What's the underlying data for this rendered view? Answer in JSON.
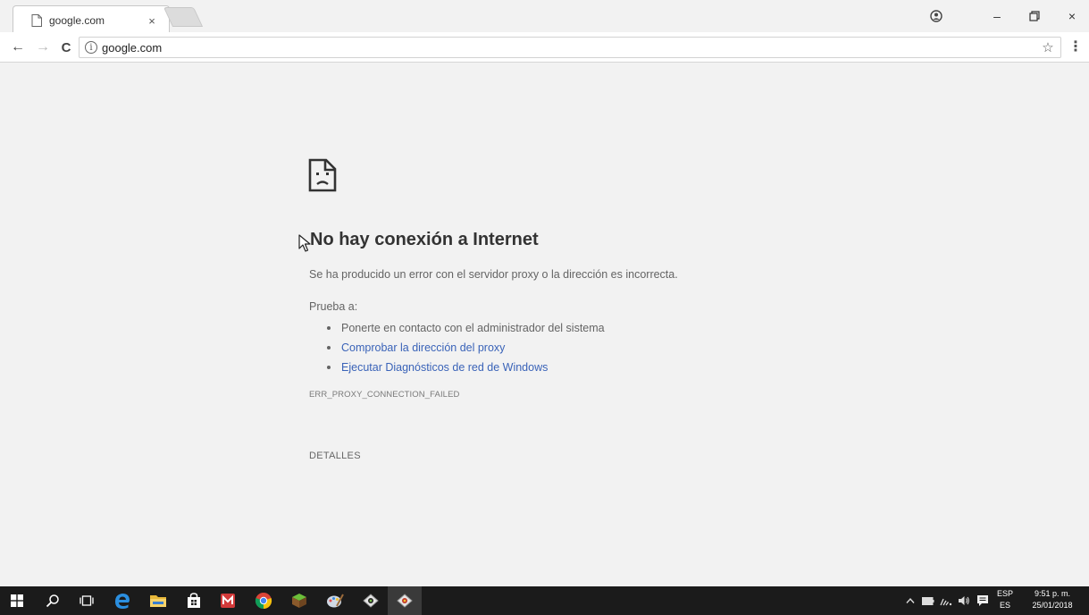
{
  "browser": {
    "tab": {
      "title": "google.com",
      "close": "×"
    },
    "window": {
      "minimize": "–",
      "restore": "▭",
      "close": "×"
    },
    "nav": {
      "back": "←",
      "forward": "→",
      "reload": "C"
    },
    "omnibox": {
      "info": "i",
      "url": "google.com",
      "star": "☆",
      "menu": "⋮"
    }
  },
  "page": {
    "title": "No hay conexión a Internet",
    "description": "Se ha producido un error con el servidor proxy o la dirección es incorrecta.",
    "try_label": "Prueba a:",
    "suggestions": [
      {
        "text": "Ponerte en contacto con el administrador del sistema",
        "link": false
      },
      {
        "text": "Comprobar la dirección del proxy",
        "link": true
      },
      {
        "text": "Ejecutar Diagnósticos de red de Windows",
        "link": true
      }
    ],
    "error_code": "ERR_PROXY_CONNECTION_FAILED",
    "details_button": "DETALLES"
  },
  "taskbar": {
    "tray": {
      "language_top": "ESP",
      "language_bottom": "ES",
      "time": "9:51 p. m.",
      "date": "25/01/2018"
    }
  },
  "colors": {
    "page_background": "#f2f2f2",
    "link": "#3a63b8",
    "text_secondary": "#646464",
    "taskbar": "#1b1b1b"
  }
}
